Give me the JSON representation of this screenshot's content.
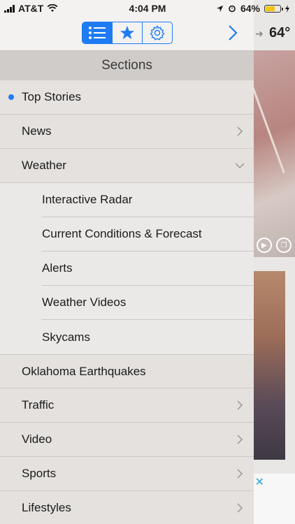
{
  "status_bar": {
    "carrier": "AT&T",
    "time": "4:04 PM",
    "battery_percent": "64%"
  },
  "background_app": {
    "temperature": "64°"
  },
  "toolbar": {
    "icons": [
      "list-icon",
      "star-icon",
      "gear-icon"
    ],
    "active_tab": "list",
    "accent_color": "#1f7bf2"
  },
  "sections": {
    "title": "Sections",
    "items": [
      {
        "label": "Top Stories"
      },
      {
        "label": "News"
      },
      {
        "label": "Weather"
      },
      {
        "label": "Interactive Radar"
      },
      {
        "label": "Current Conditions & Forecast"
      },
      {
        "label": "Alerts"
      },
      {
        "label": "Weather Videos"
      },
      {
        "label": "Skycams"
      },
      {
        "label": "Oklahoma Earthquakes"
      },
      {
        "label": "Traffic"
      },
      {
        "label": "Video"
      },
      {
        "label": "Sports"
      },
      {
        "label": "Lifestyles"
      }
    ]
  }
}
